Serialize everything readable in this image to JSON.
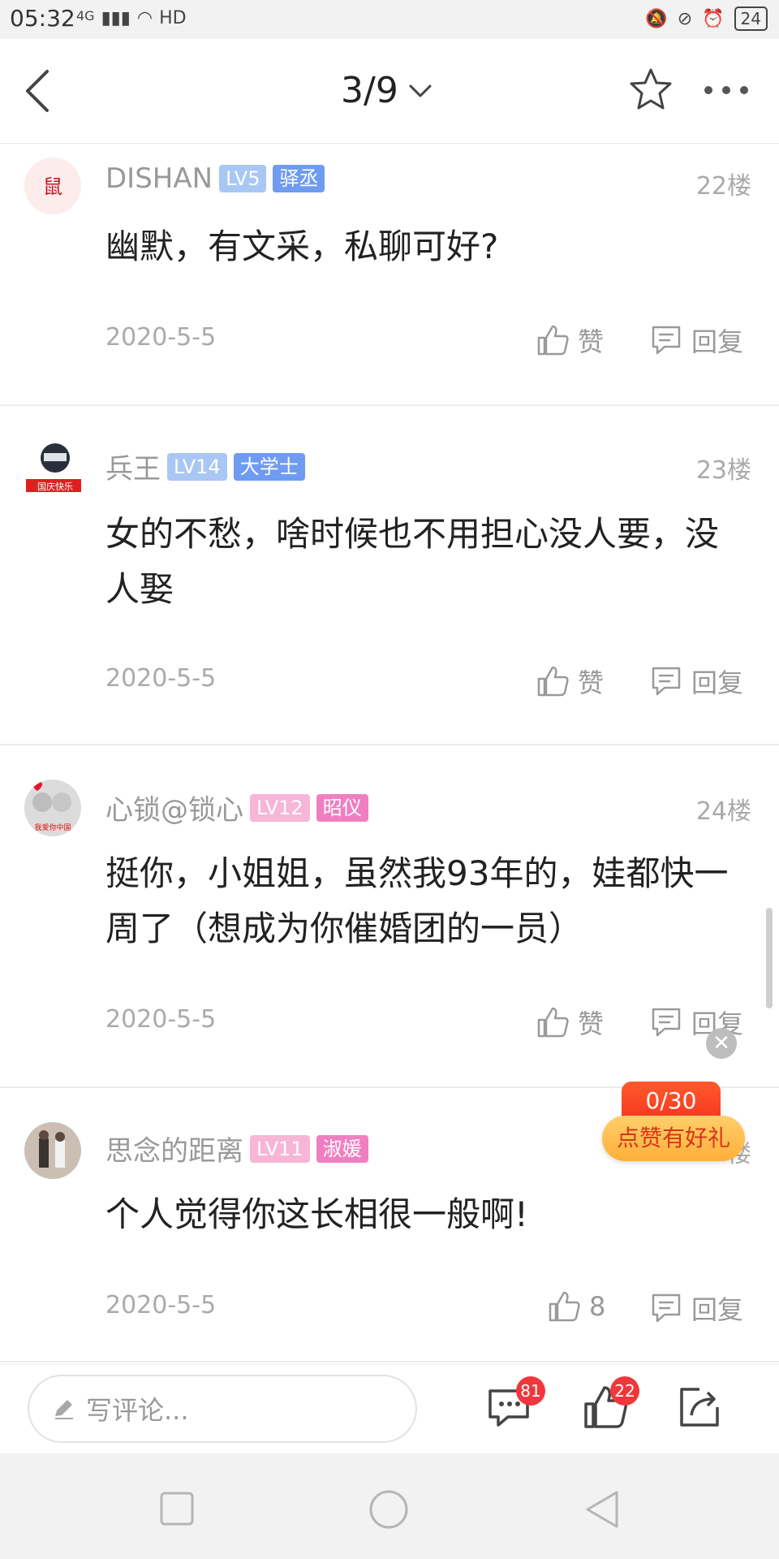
{
  "status_bar": {
    "time": "05:32",
    "network": "4G",
    "hd": "HD",
    "battery": "24"
  },
  "header": {
    "page_indicator": "3/9"
  },
  "comments": [
    {
      "username": "DISHAN",
      "level": "LV5",
      "title": "驿丞",
      "floor": "22楼",
      "content": "幽默，有文采，私聊可好?",
      "date": "2020-5-5",
      "like_label": "赞",
      "reply_label": "回复"
    },
    {
      "username": "兵王",
      "level": "LV14",
      "title": "大学士",
      "floor": "23楼",
      "content": "女的不愁，啥时候也不用担心没人要，没人娶",
      "date": "2020-5-5",
      "like_label": "赞",
      "reply_label": "回复",
      "avatar_caption": "国庆快乐"
    },
    {
      "username": "心锁@锁心",
      "level": "LV12",
      "title": "昭仪",
      "floor": "24楼",
      "content": "挺你，小姐姐，虽然我93年的，娃都快一周了（想成为你催婚团的一员）",
      "date": "2020-5-5",
      "like_label": "赞",
      "reply_label": "回复",
      "avatar_caption": "我爱你中国"
    },
    {
      "username": "思念的距离",
      "level": "LV11",
      "title": "淑媛",
      "floor": "楼",
      "content": "个人觉得你这长相很一般啊!",
      "date": "2020-5-5",
      "like_label": "8",
      "reply_label": "回复"
    }
  ],
  "promo": {
    "count": "0/30",
    "label": "点赞有好礼"
  },
  "bottom_bar": {
    "input_placeholder": "写评论...",
    "comment_count": "81",
    "like_count": "22"
  },
  "colors": {
    "accent_red": "#f0373c",
    "lv_blue": "#a9c7f5",
    "title_blue": "#6f9bf1",
    "lv_pink": "#f7b6d8",
    "title_pink": "#f07fc0"
  }
}
